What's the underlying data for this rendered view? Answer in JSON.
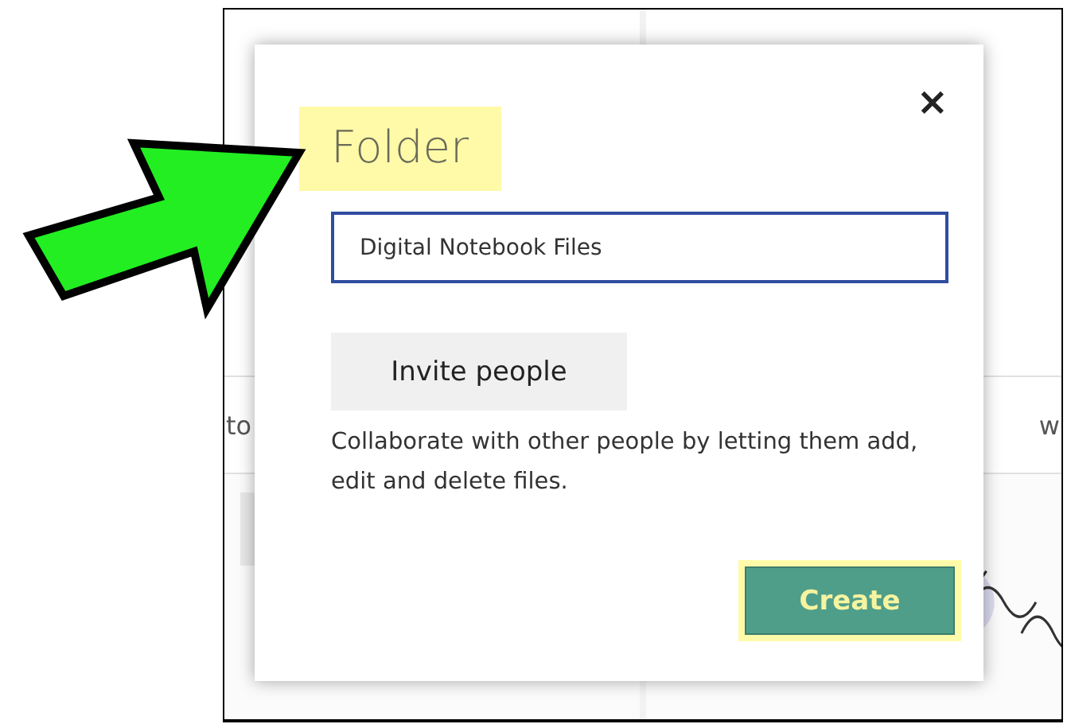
{
  "background": {
    "tiles": [
      {
        "label": "to"
      },
      {
        "label": "w"
      }
    ]
  },
  "dialog": {
    "title": {
      "text": "Folder",
      "highlighted": true
    },
    "close": "×",
    "name_field": {
      "value": "Digital Notebook Files",
      "focused": true
    },
    "invite_button": "Invite people",
    "description": "Collaborate with other people by letting them add, edit and delete files.",
    "create_button": {
      "label": "Create",
      "highlighted": true
    }
  }
}
